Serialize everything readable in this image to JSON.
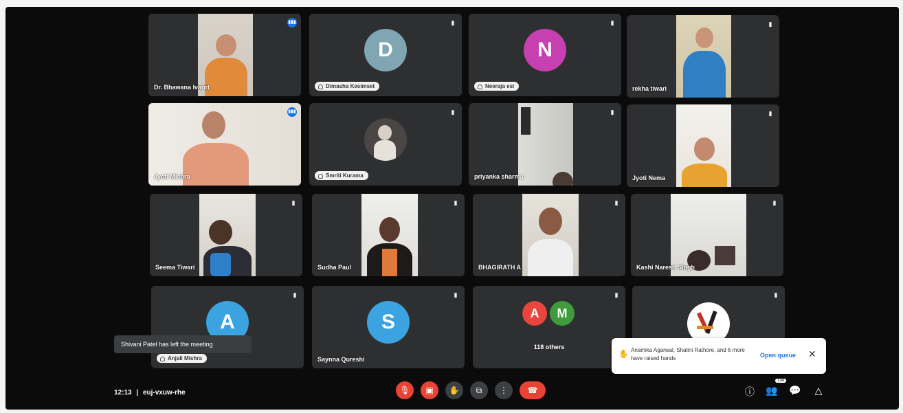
{
  "participants": [
    {
      "name": "Dr. Bhawana Ivanrt",
      "mic": "active",
      "type": "video"
    },
    {
      "name": "Dimasha Kesimset",
      "mic": "muted",
      "type": "avatar",
      "initial": "D",
      "color": "#7fa6b2"
    },
    {
      "name": "Neeraja esi",
      "mic": "muted",
      "type": "avatar",
      "initial": "N",
      "color": "#c640b2"
    },
    {
      "name": "rekha tiwari",
      "mic": "muted",
      "type": "video"
    },
    {
      "name": "Jyoti Mishra",
      "mic": "active",
      "type": "video"
    },
    {
      "name": "Smriti Kurama",
      "mic": "muted",
      "type": "photo"
    },
    {
      "name": "priyanka sharma",
      "mic": "muted",
      "type": "video"
    },
    {
      "name": "Jyoti Nema",
      "mic": "muted",
      "type": "video"
    },
    {
      "name": "Seema Tiwari",
      "mic": "muted",
      "type": "video"
    },
    {
      "name": "Sudha Paul",
      "mic": "muted",
      "type": "video"
    },
    {
      "name": "BHAGIRATH A",
      "mic": "muted",
      "type": "video"
    },
    {
      "name": "Kashi Naresh Singh",
      "mic": "muted",
      "type": "video"
    },
    {
      "name": "Anjali Mishra",
      "mic": "muted",
      "type": "avatar",
      "initial": "A",
      "color": "#3aa3e0"
    },
    {
      "name": "Saynna Qureshi",
      "mic": "muted",
      "type": "avatar",
      "initial": "S",
      "color": "#3aa3e0"
    },
    {
      "name": "118 others",
      "mic": "muted",
      "type": "others",
      "initials": [
        "A",
        "M"
      ],
      "colors": [
        "#e8453c",
        "#3f9b3b"
      ]
    },
    {
      "name": "",
      "mic": "muted",
      "type": "logo"
    }
  ],
  "toast_left": {
    "text": "Shivani Patel has left the meeting"
  },
  "toast_right": {
    "message": "Anamika Agarwal, Shalini Rathore, and 6 more have raised hands",
    "link": "Open queue",
    "close": "✕"
  },
  "footer": {
    "time": "12:13",
    "separator": "|",
    "meeting_code": "euj-vxuw-rhe",
    "participants_badge": "134"
  },
  "colors": {
    "end_call": "#ea4335",
    "mic_active": "#1a73e8",
    "tile_bg": "#2e2f31"
  }
}
